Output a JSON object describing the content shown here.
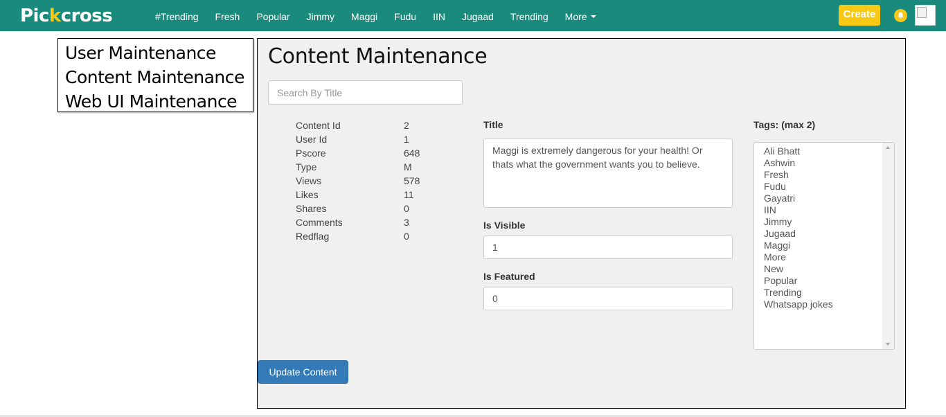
{
  "navbar": {
    "brand_before": "Pic",
    "brand_accent": "k",
    "brand_after": "cross",
    "links": [
      "#Trending",
      "Fresh",
      "Popular",
      "Jimmy",
      "Maggi",
      "Fudu",
      "IIN",
      "Jugaad",
      "Trending"
    ],
    "more_label": "More",
    "create_label": "Create",
    "colors": {
      "bar": "#1a8a7d",
      "accent": "#f7c915"
    }
  },
  "sidebar": {
    "items": [
      "User Maintenance",
      "Content Maintenance",
      "Web UI Maintenance"
    ]
  },
  "main": {
    "title": "Content Maintenance",
    "search_placeholder": "Search By Title",
    "meta": [
      {
        "key": "Content Id",
        "value": "2"
      },
      {
        "key": "User Id",
        "value": "1"
      },
      {
        "key": "Pscore",
        "value": "648"
      },
      {
        "key": "Type",
        "value": "M"
      },
      {
        "key": "Views",
        "value": "578"
      },
      {
        "key": "Likes",
        "value": "11"
      },
      {
        "key": "Shares",
        "value": "0"
      },
      {
        "key": "Comments",
        "value": "3"
      },
      {
        "key": "Redflag",
        "value": "0"
      }
    ],
    "title_label": "Title",
    "title_value": "Maggi is extremely dangerous for your health! Or thats what the government wants you to believe.",
    "visible_label": "Is Visible",
    "visible_value": "1",
    "featured_label": "Is Featured",
    "featured_value": "0",
    "tags_label": "Tags: (max 2)",
    "tags": [
      "Ali Bhatt",
      "Ashwin",
      "Fresh",
      "Fudu",
      "Gayatri",
      "IIN",
      "Jimmy",
      "Jugaad",
      "Maggi",
      "More",
      "New",
      "Popular",
      "Trending",
      "Whatsapp jokes"
    ],
    "update_button": "Update Content"
  }
}
